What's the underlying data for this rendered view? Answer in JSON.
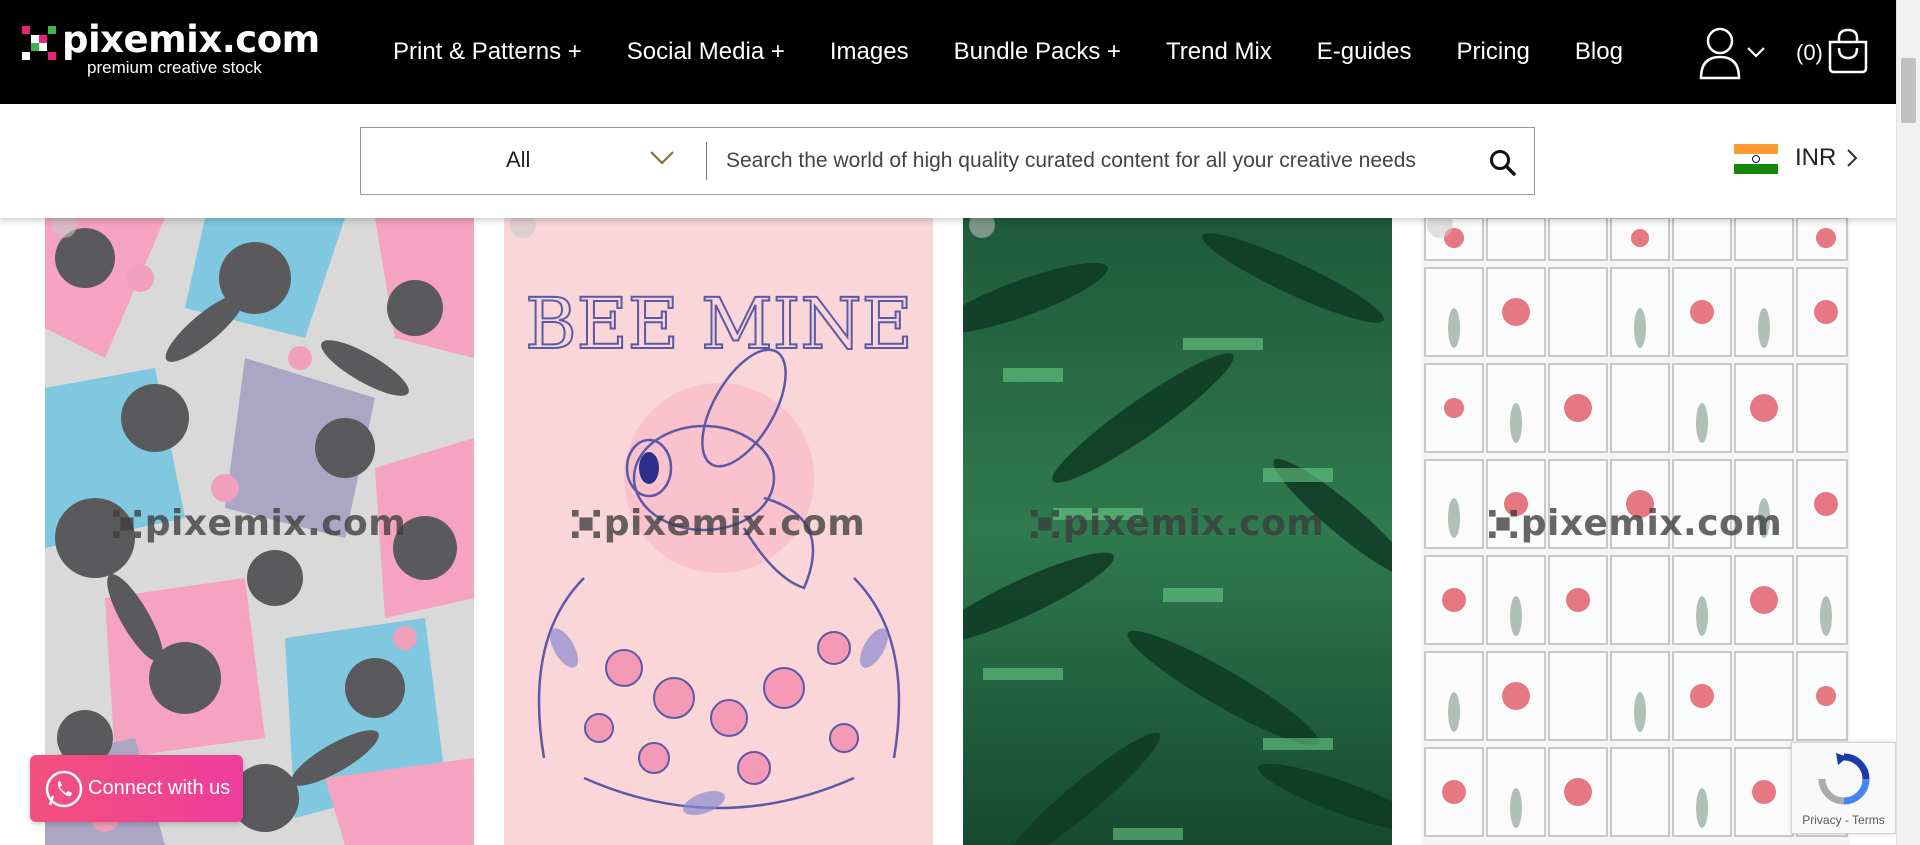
{
  "brand": {
    "name": "pixemix.com",
    "tagline": "premium creative stock"
  },
  "nav": {
    "items": [
      {
        "label": "Print & Patterns +"
      },
      {
        "label": "Social Media +"
      },
      {
        "label": "Images"
      },
      {
        "label": "Bundle Packs +"
      },
      {
        "label": "Trend Mix"
      },
      {
        "label": "E-guides"
      },
      {
        "label": "Pricing"
      },
      {
        "label": "Blog"
      }
    ]
  },
  "account": {
    "icon": "user-icon"
  },
  "cart": {
    "count_label": "(0)",
    "icon": "shopping-bag-icon"
  },
  "search": {
    "category": "All",
    "placeholder": "Search the world of high quality curated content for all your creative needs",
    "icon": "search-icon"
  },
  "currency": {
    "code": "INR",
    "flag": "india-flag-icon"
  },
  "products": [
    {
      "watermark": "pixemix.com",
      "art_text": ""
    },
    {
      "watermark": "pixemix.com",
      "art_text": "BEE MINE"
    },
    {
      "watermark": "pixemix.com",
      "art_text": ""
    },
    {
      "watermark": "pixemix.com",
      "art_text": ""
    }
  ],
  "floating": {
    "connect_label": "Connect with us",
    "recaptcha_links": "Privacy - Terms"
  },
  "colors": {
    "header_bg": "#000000",
    "connect_gradient_start": "#f2517d",
    "connect_gradient_end": "#ee3d9c",
    "logo_pink": "#e8237a",
    "logo_green": "#3cb54a"
  }
}
